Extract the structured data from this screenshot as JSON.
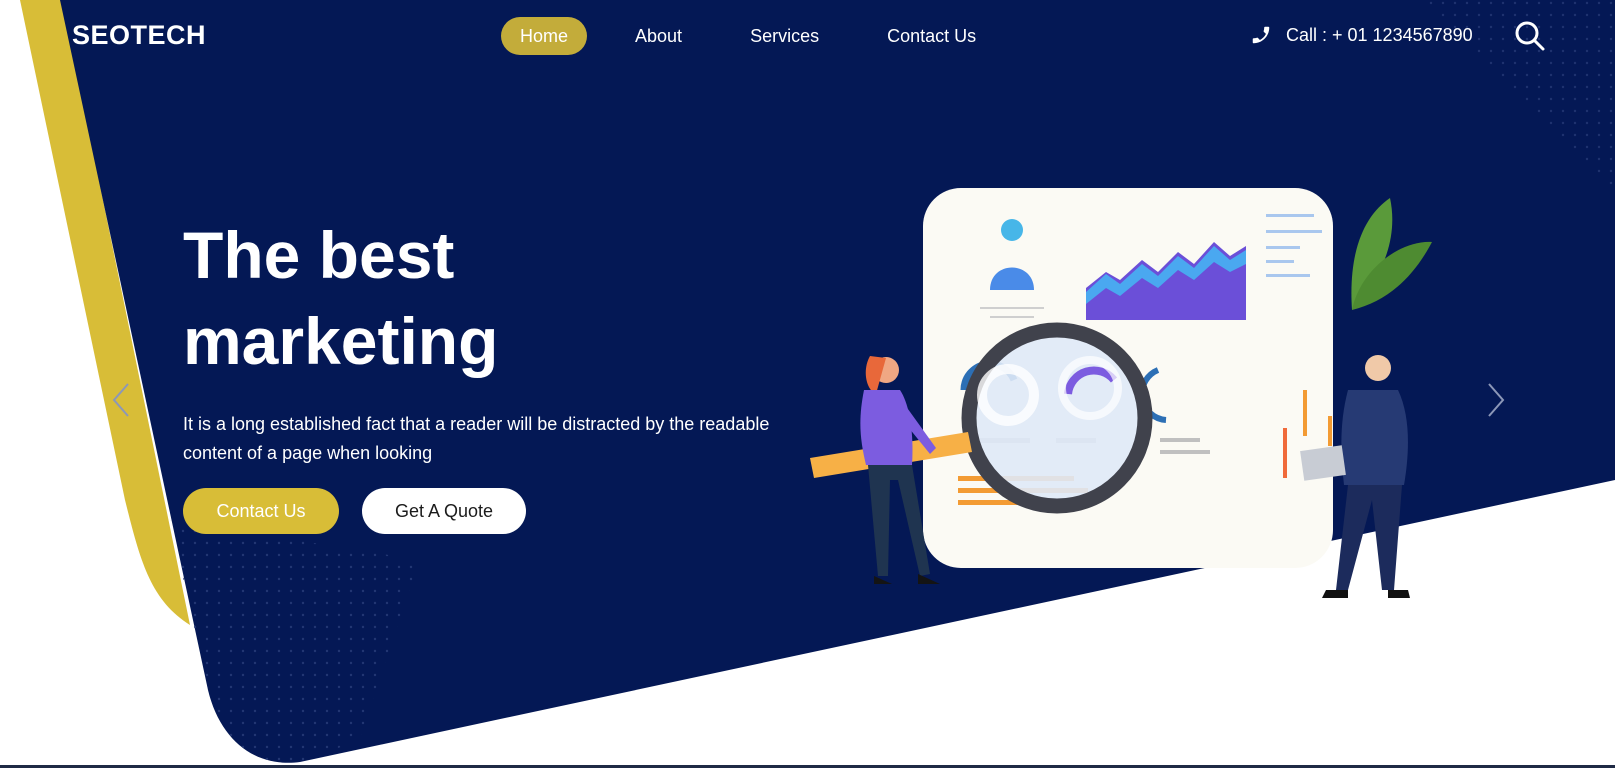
{
  "brand": {
    "logo": "SEOTECH"
  },
  "nav": {
    "items": [
      {
        "label": "Home",
        "active": true
      },
      {
        "label": "About",
        "active": false
      },
      {
        "label": "Services",
        "active": false
      },
      {
        "label": "Contact Us",
        "active": false
      }
    ]
  },
  "header": {
    "call_text": "Call : + 01 1234567890",
    "phone_icon": "phone-icon",
    "search_icon": "search-icon"
  },
  "hero": {
    "title_line1": "The best",
    "title_line2": "marketing",
    "description": "It is a long established fact that a reader will be distracted by the readable content of a page when looking",
    "primary_button": "Contact Us",
    "secondary_button": "Get A Quote"
  },
  "carousel": {
    "prev_icon": "chevron-left-icon",
    "next_icon": "chevron-right-icon"
  },
  "colors": {
    "navy": "#041855",
    "gold": "#d8bd37",
    "nav_active": "#c3ac3a",
    "white": "#ffffff"
  }
}
